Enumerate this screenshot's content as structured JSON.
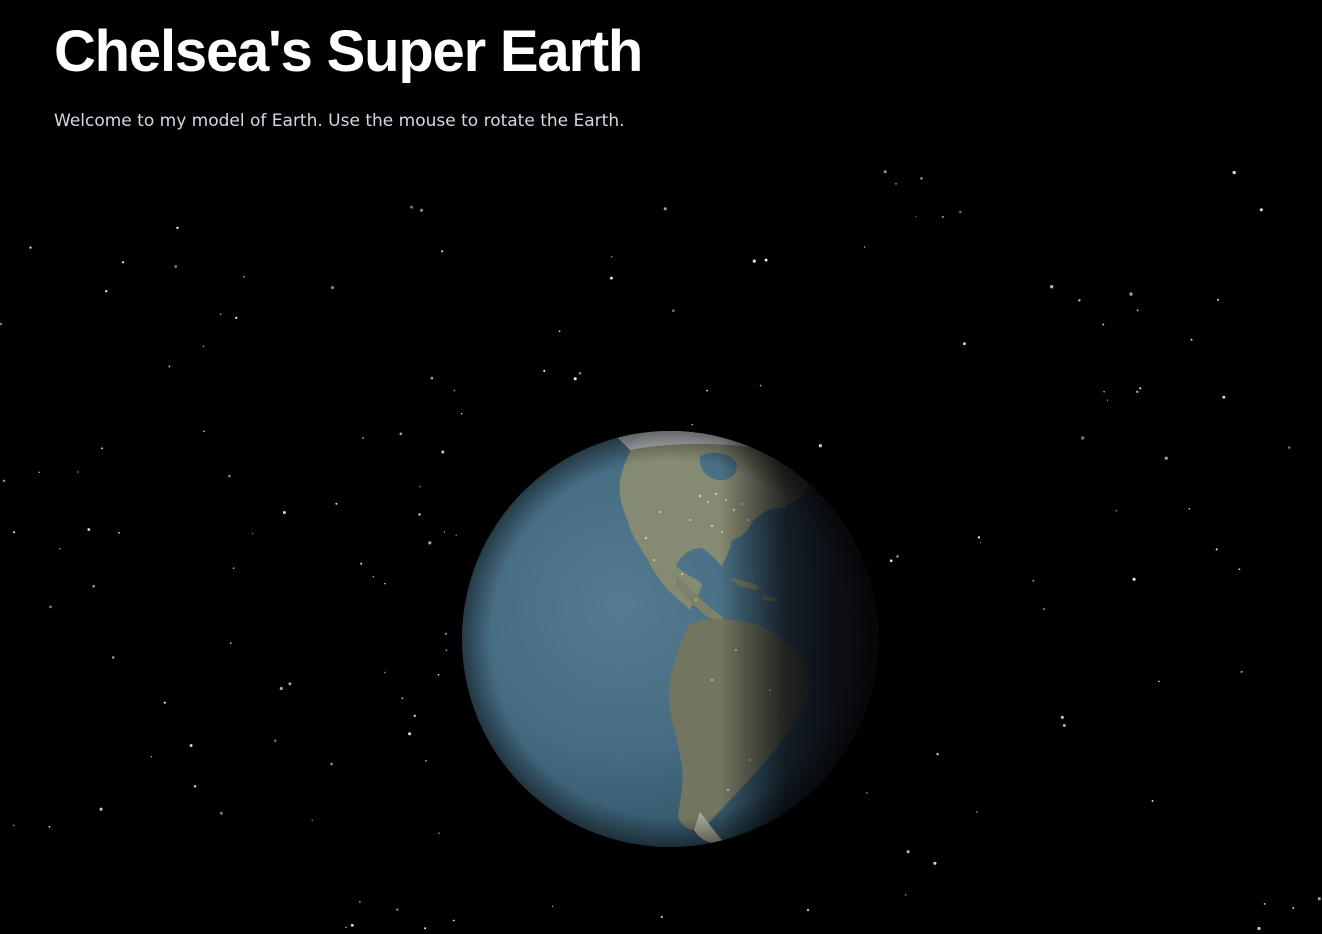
{
  "page": {
    "title": "Chelsea's Super Earth",
    "subtitle": "Welcome to my model of Earth. Use the mouse to rotate the Earth."
  },
  "scene": {
    "background_color": "#000000",
    "star_color": "#ffffff",
    "globe": {
      "ocean_color": "#4d7388",
      "land_color": "#7d8067",
      "ice_color": "#c9ccd2",
      "shadow_color": "#0c0d12"
    }
  }
}
